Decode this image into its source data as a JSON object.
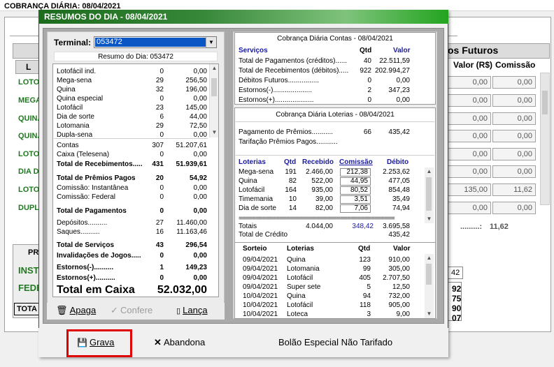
{
  "background": {
    "title": "COBRANÇA DIÁRIA: 08/04/2021",
    "futuros_header": "os Futuros",
    "col_headers": [
      "Valor (R$)",
      "Comissão"
    ],
    "first_col_header": "L",
    "row_labels": [
      "LOTO",
      "MEGA",
      "QUINA",
      "QUINA",
      "LOTO",
      "DIA DE",
      "LOTO",
      "DUPLA"
    ],
    "rows": [
      [
        "0,00",
        "0,00"
      ],
      [
        "0,00",
        "0,00"
      ],
      [
        "0,00",
        "0,00"
      ],
      [
        "0,00",
        "0,00"
      ],
      [
        "0,00",
        "0,00"
      ],
      [
        "0,00",
        "0,00"
      ],
      [
        "135,00",
        "11,62"
      ],
      [
        "0,00",
        "0,00"
      ]
    ],
    "sum_label": ".........:",
    "sum_value": "11,62",
    "bottom_labels": [
      "PR",
      "INST",
      "FEDE"
    ],
    "bottom_total": "TOTA",
    "right_numbers": [
      "42",
      "92",
      "75",
      "90",
      "07"
    ]
  },
  "dialog": {
    "title": "RESUMOS DO DIA - 08/04/2021",
    "terminal_label": "Terminal:",
    "terminal_value": "053472",
    "resumo_caption": "Resumo do Dia: 053472",
    "games": [
      {
        "name": "Lotofácil ind.",
        "qty": "0",
        "val": "0,00"
      },
      {
        "name": "Mega-sena",
        "qty": "29",
        "val": "256,50"
      },
      {
        "name": "Quina",
        "qty": "32",
        "val": "196,00"
      },
      {
        "name": "Quina especial",
        "qty": "0",
        "val": "0,00"
      },
      {
        "name": "Lotofácil",
        "qty": "23",
        "val": "145,00"
      },
      {
        "name": "Dia de sorte",
        "qty": "6",
        "val": "44,00"
      },
      {
        "name": "Lotomania",
        "qty": "29",
        "val": "72,50"
      },
      {
        "name": "Dupla-sena",
        "qty": "0",
        "val": "0,00"
      }
    ],
    "contas": {
      "name": "Contas",
      "qty": "307",
      "val": "51.207,61"
    },
    "caixa": {
      "name": "Caixa (Telesena)",
      "qty": "0",
      "val": "0,00"
    },
    "total_receb": {
      "name": "Total de Recebimentos.....",
      "qty": "431",
      "val": "51.939,61"
    },
    "total_premios": {
      "name": "Total de Prêmios Pagos",
      "qty": "20",
      "val": "54,92"
    },
    "comissao_inst": {
      "name": "Comissão: Instantânea",
      "qty": "0",
      "val": "0,00"
    },
    "comissao_fed": {
      "name": "Comissão: Federal",
      "qty": "0",
      "val": "0,00"
    },
    "total_pag": {
      "name": "Total de Pagamentos",
      "qty": "0",
      "val": "0,00"
    },
    "depositos": {
      "name": "Depósitos..........",
      "qty": "27",
      "val": "11.460,00"
    },
    "saques": {
      "name": "Saques..........",
      "qty": "16",
      "val": "11.163,46"
    },
    "total_serv": {
      "name": "Total de Serviços",
      "qty": "43",
      "val": "296,54"
    },
    "invalidacoes": {
      "name": "Invalidações de Jogos.....",
      "qty": "0",
      "val": "0,00"
    },
    "estornos_menos": {
      "name": "Estornos(-)..........",
      "qty": "1",
      "val": "149,23"
    },
    "estornos_mais": {
      "name": "Estornos(+)..........",
      "qty": "0",
      "val": "0,00"
    },
    "total_caixa": {
      "name": "Total em Caixa",
      "val": "52.032,00"
    },
    "btn_apaga": "Apaga",
    "btn_confere": "Confere",
    "btn_lanca": "Lança",
    "contas_caption": "Cobrança Diária Contas - 08/04/2021",
    "contas_headers": {
      "servicos": "Serviços",
      "qtd": "Qtd",
      "valor": "Valor"
    },
    "contas_rows": [
      {
        "name": "Total de Pagamentos (créditos)......",
        "qty": "40",
        "val": "22.511,59"
      },
      {
        "name": "Total de Recebimentos (débitos).....",
        "qty": "922",
        "val": "202.994,27"
      },
      {
        "name": "Débitos Futuros................",
        "qty": "0",
        "val": "0,00"
      },
      {
        "name": "Estornos(-)....................",
        "qty": "2",
        "val": "347,23"
      },
      {
        "name": "Estornos(+)....................",
        "qty": "0",
        "val": "0,00"
      }
    ],
    "loterias_caption": "Cobrança Diária Loterias - 08/04/2021",
    "pagamento_premios": {
      "name": "Pagamento de Prêmios...........",
      "qty": "66",
      "val": "435,42"
    },
    "tarifacao": "Tarifação Prêmios Pagos...........",
    "lot_headers": {
      "loterias": "Loterias",
      "qtd": "Qtd",
      "recebido": "Recebido",
      "comissao": "Comissão",
      "debito": "Débito"
    },
    "lot_rows": [
      {
        "name": "Mega-sena",
        "qty": "191",
        "rec": "2.466,00",
        "com": "212,38",
        "deb": "2.253,62"
      },
      {
        "name": "Quina",
        "qty": "82",
        "rec": "522,00",
        "com": "44,95",
        "deb": "477,05"
      },
      {
        "name": "Lotofácil",
        "qty": "164",
        "rec": "935,00",
        "com": "80,52",
        "deb": "854,48"
      },
      {
        "name": "Timemania",
        "qty": "10",
        "rec": "39,00",
        "com": "3,51",
        "deb": "35,49"
      },
      {
        "name": "Dia de sorte",
        "qty": "14",
        "rec": "82,00",
        "com": "7,06",
        "deb": "74,94"
      }
    ],
    "lot_dashes": "==============================================",
    "lot_totais": {
      "name": "Totais",
      "rec": "4.044,00",
      "com": "348,42",
      "deb": "3.695,58"
    },
    "lot_total_credito": {
      "name": "Total de Crédito",
      "val": "435,42"
    },
    "sorteio_headers": {
      "sorteio": "Sorteio",
      "loterias": "Loterias",
      "qtd": "Qtd",
      "valor": "Valor"
    },
    "sorteio_rows": [
      {
        "date": "09/04/2021",
        "name": "Quina",
        "qty": "123",
        "val": "910,00"
      },
      {
        "date": "09/04/2021",
        "name": "Lotomania",
        "qty": "99",
        "val": "305,00"
      },
      {
        "date": "09/04/2021",
        "name": "Lotofácil",
        "qty": "405",
        "val": "2.707,50"
      },
      {
        "date": "09/04/2021",
        "name": "Super sete",
        "qty": "5",
        "val": "12,50"
      },
      {
        "date": "10/04/2021",
        "name": "Quina",
        "qty": "94",
        "val": "732,00"
      },
      {
        "date": "10/04/2021",
        "name": "Lotofácil",
        "qty": "118",
        "val": "905,00"
      },
      {
        "date": "10/04/2021",
        "name": "Loteca",
        "qty": "3",
        "val": "9,00"
      }
    ],
    "btn_grava": "Grava",
    "btn_abandona": "Abandona",
    "bolao_text": "Bolão Especial Não Tarifado"
  }
}
